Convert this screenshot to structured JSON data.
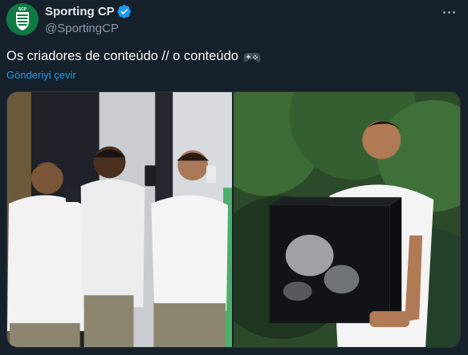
{
  "tweet": {
    "display_name": "Sporting CP",
    "handle": "@SportingCP",
    "text": "Os criadores de conteúdo // o conteúdo",
    "translate_label": "Gönderiyi çevir",
    "avatar_text": "SCP"
  },
  "icons": {
    "verified": "verified-badge-icon",
    "more": "more-options-icon",
    "emoji": "video-game-controller-icon"
  },
  "colors": {
    "background": "#15202b",
    "link": "#1d9bf0",
    "verified": "#1d9bf0",
    "brand_green": "#0e7a46",
    "secondary_text": "#8b98a5"
  },
  "media": {
    "count": 2
  }
}
